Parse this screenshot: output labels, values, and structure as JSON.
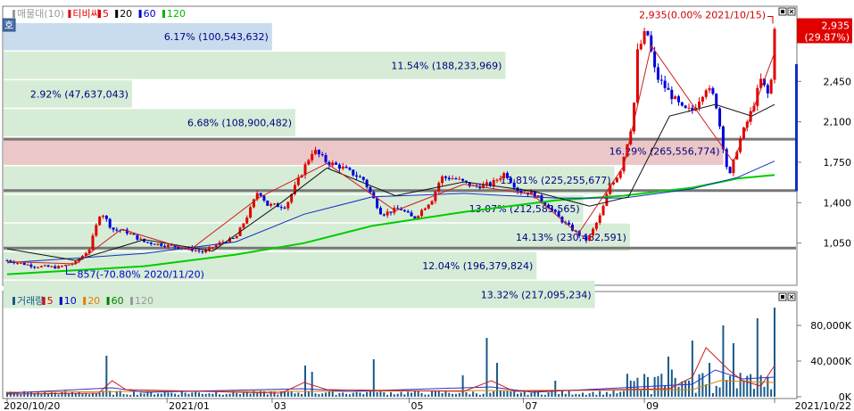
{
  "chart_data": [
    {
      "type": "candlestick",
      "legend": {
        "items": [
          "매물대(10)",
          "티비씨",
          "5",
          "20",
          "60",
          "120"
        ],
        "colors": [
          "#9a9a9a",
          "#e00000",
          "#e00000",
          "#000000",
          "#0000cc",
          "#00bb00"
        ]
      },
      "mode_button": "호",
      "ylim": [
        700,
        2985
      ],
      "yticks": [
        {
          "value": 2450,
          "label": "2,450"
        },
        {
          "value": 2100,
          "label": "2,100"
        },
        {
          "value": 1750,
          "label": "1,750"
        },
        {
          "value": 1400,
          "label": "1,400"
        },
        {
          "value": 1050,
          "label": "1,050"
        }
      ],
      "volume_profile": [
        {
          "low": 2719,
          "high": 2955,
          "pct_label": "6.17% (100,543,632)",
          "ratio": 0.345,
          "color": "#c8dcee"
        },
        {
          "low": 2471,
          "high": 2707,
          "pct_label": "11.54% (188,233,969)",
          "ratio": 0.645,
          "color": "#d6ecd6"
        },
        {
          "low": 2223,
          "high": 2459,
          "pct_label": "2.92% (47,637,043)",
          "ratio": 0.165,
          "color": "#d6ecd6"
        },
        {
          "low": 1975,
          "high": 2211,
          "pct_label": "6.68% (108,900,482)",
          "ratio": 0.375,
          "color": "#d6ecd6"
        },
        {
          "low": 1727,
          "high": 1963,
          "pct_label": "16.29% (265,556,774)",
          "ratio": 0.925,
          "color": "#ecc7c7"
        },
        {
          "low": 1479,
          "high": 1715,
          "pct_label": "13.81% (225,255,677)",
          "ratio": 0.785,
          "color": "#d6ecd6"
        },
        {
          "low": 1231,
          "high": 1467,
          "pct_label": "13.07% (212,583,565)",
          "ratio": 0.745,
          "color": "#d6ecd6"
        },
        {
          "low": 983,
          "high": 1219,
          "pct_label": "14.13% (230,482,591)",
          "ratio": 0.805,
          "color": "#d6ecd6"
        },
        {
          "low": 735,
          "high": 971,
          "pct_label": "12.04% (196,379,824)",
          "ratio": 0.685,
          "color": "#d6ecd6"
        },
        {
          "low": 487,
          "high": 723,
          "pct_label": "13.32% (217,095,234)",
          "ratio": 0.76,
          "color": "#d6ecd6"
        }
      ],
      "support_lines": [
        1950,
        1505,
        1007
      ],
      "price": [
        [
          0,
          900
        ],
        [
          12,
          850
        ],
        [
          22,
          840
        ],
        [
          30,
          880
        ],
        [
          36,
          1000
        ],
        [
          41,
          1330
        ],
        [
          46,
          1170
        ],
        [
          52,
          1150
        ],
        [
          60,
          1060
        ],
        [
          70,
          1030
        ],
        [
          80,
          1000
        ],
        [
          86,
          970
        ],
        [
          94,
          1060
        ],
        [
          100,
          1090
        ],
        [
          106,
          1320
        ],
        [
          110,
          1510
        ],
        [
          114,
          1380
        ],
        [
          122,
          1370
        ],
        [
          130,
          1700
        ],
        [
          134,
          1860
        ],
        [
          140,
          1750
        ],
        [
          146,
          1710
        ],
        [
          156,
          1600
        ],
        [
          164,
          1300
        ],
        [
          172,
          1350
        ],
        [
          178,
          1260
        ],
        [
          186,
          1430
        ],
        [
          190,
          1620
        ],
        [
          196,
          1610
        ],
        [
          204,
          1540
        ],
        [
          212,
          1560
        ],
        [
          218,
          1660
        ],
        [
          224,
          1500
        ],
        [
          230,
          1480
        ],
        [
          236,
          1390
        ],
        [
          242,
          1260
        ],
        [
          248,
          1160
        ],
        [
          254,
          1070
        ],
        [
          260,
          1300
        ],
        [
          264,
          1560
        ],
        [
          268,
          1650
        ],
        [
          274,
          2120
        ],
        [
          276,
          2700
        ],
        [
          280,
          2900
        ],
        [
          284,
          2500
        ],
        [
          288,
          2400
        ],
        [
          296,
          2200
        ],
        [
          300,
          2200
        ],
        [
          306,
          2400
        ],
        [
          310,
          2300
        ],
        [
          316,
          1600
        ],
        [
          320,
          1900
        ],
        [
          326,
          2200
        ],
        [
          330,
          2460
        ],
        [
          334,
          2300
        ],
        [
          336,
          2935
        ]
      ],
      "ma5": [
        [
          0,
          890
        ],
        [
          30,
          870
        ],
        [
          50,
          1170
        ],
        [
          80,
          990
        ],
        [
          110,
          1440
        ],
        [
          140,
          1740
        ],
        [
          170,
          1330
        ],
        [
          200,
          1560
        ],
        [
          230,
          1470
        ],
        [
          250,
          1130
        ],
        [
          270,
          1720
        ],
        [
          282,
          2760
        ],
        [
          300,
          2250
        ],
        [
          318,
          1750
        ],
        [
          336,
          2700
        ]
      ],
      "ma20": [
        [
          0,
          1000
        ],
        [
          30,
          900
        ],
        [
          60,
          1080
        ],
        [
          90,
          980
        ],
        [
          120,
          1400
        ],
        [
          140,
          1700
        ],
        [
          170,
          1460
        ],
        [
          200,
          1580
        ],
        [
          230,
          1500
        ],
        [
          255,
          1370
        ],
        [
          272,
          1450
        ],
        [
          290,
          2150
        ],
        [
          310,
          2250
        ],
        [
          326,
          2150
        ],
        [
          336,
          2250
        ]
      ],
      "ma60": [
        [
          0,
          880
        ],
        [
          60,
          960
        ],
        [
          100,
          1060
        ],
        [
          130,
          1300
        ],
        [
          160,
          1450
        ],
        [
          200,
          1480
        ],
        [
          240,
          1440
        ],
        [
          270,
          1440
        ],
        [
          300,
          1520
        ],
        [
          320,
          1620
        ],
        [
          336,
          1760
        ]
      ],
      "ma120": [
        [
          0,
          780
        ],
        [
          60,
          850
        ],
        [
          100,
          950
        ],
        [
          130,
          1050
        ],
        [
          160,
          1200
        ],
        [
          200,
          1320
        ],
        [
          240,
          1420
        ],
        [
          270,
          1460
        ],
        [
          300,
          1530
        ],
        [
          320,
          1610
        ],
        [
          336,
          1640
        ]
      ],
      "high_annotation": "2,935(0.00% 2021/10/15)",
      "low_annotation": "857(-70.80% 2020/11/20)",
      "current_price": "2,935",
      "current_change": "(29.87%)"
    },
    {
      "type": "bar",
      "legend": {
        "items": [
          "거래량",
          "5",
          "10",
          "20",
          "60",
          "120"
        ],
        "colors": [
          "#1a5a8a",
          "#e00000",
          "#0000cc",
          "#e08000",
          "#008000",
          "#9a9a9a"
        ]
      },
      "ylim": [
        0,
        100000
      ],
      "yticks": [
        {
          "value": 80000,
          "label": "80,000K"
        },
        {
          "value": 40000,
          "label": "40,000K"
        },
        {
          "value": 0,
          "label": "0K"
        }
      ],
      "spikes": [
        [
          44,
          46000
        ],
        [
          130,
          35000
        ],
        [
          134,
          28000
        ],
        [
          200,
          24000
        ],
        [
          210,
          66000
        ],
        [
          214,
          38000
        ],
        [
          300,
          63000
        ],
        [
          307,
          38000
        ],
        [
          314,
          80000
        ],
        [
          160,
          42000
        ],
        [
          240,
          18000
        ],
        [
          290,
          45000
        ],
        [
          318,
          60000
        ],
        [
          328,
          88000
        ],
        [
          336,
          100000
        ]
      ],
      "ma5": [
        [
          0,
          3000
        ],
        [
          40,
          4000
        ],
        [
          46,
          18000
        ],
        [
          52,
          8000
        ],
        [
          120,
          4000
        ],
        [
          130,
          16000
        ],
        [
          140,
          8000
        ],
        [
          200,
          6000
        ],
        [
          212,
          18000
        ],
        [
          222,
          6000
        ],
        [
          290,
          9000
        ],
        [
          300,
          22000
        ],
        [
          306,
          55000
        ],
        [
          316,
          30000
        ],
        [
          322,
          18000
        ],
        [
          330,
          12000
        ],
        [
          336,
          35000
        ]
      ],
      "ma10": [
        [
          0,
          4000
        ],
        [
          46,
          10000
        ],
        [
          60,
          5000
        ],
        [
          130,
          9000
        ],
        [
          150,
          6000
        ],
        [
          212,
          11000
        ],
        [
          230,
          5000
        ],
        [
          300,
          14000
        ],
        [
          310,
          30000
        ],
        [
          322,
          20000
        ],
        [
          336,
          22000
        ]
      ],
      "ma20": [
        [
          0,
          5000
        ],
        [
          60,
          6000
        ],
        [
          140,
          6000
        ],
        [
          220,
          7000
        ],
        [
          300,
          8000
        ],
        [
          312,
          18000
        ],
        [
          336,
          16000
        ]
      ]
    }
  ],
  "x_axis": {
    "labels": [
      {
        "day": 0,
        "text": "2020/10/20"
      },
      {
        "day": 70,
        "text": "2021/01"
      },
      {
        "day": 116,
        "text": "03"
      },
      {
        "day": 176,
        "text": "05"
      },
      {
        "day": 226,
        "text": "07"
      },
      {
        "day": 279,
        "text": "09"
      },
      {
        "day": 336,
        "text": "2021/10/22"
      }
    ]
  }
}
